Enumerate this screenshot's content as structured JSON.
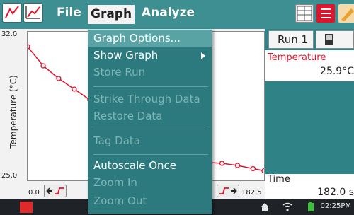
{
  "menubar": {
    "file_label": "File",
    "graph_label": "Graph",
    "analyze_label": "Analyze"
  },
  "dropdown": {
    "items": [
      {
        "label": "Graph Options...",
        "enabled": true,
        "selected": true
      },
      {
        "label": "Show Graph",
        "enabled": true,
        "submenu": true
      },
      {
        "label": "Store Run",
        "enabled": false
      },
      {
        "label": "Strike Through Data",
        "enabled": false
      },
      {
        "label": "Restore Data",
        "enabled": false
      },
      {
        "label": "Tag Data",
        "enabled": false
      },
      {
        "label": "Autoscale Once",
        "enabled": true
      },
      {
        "label": "Zoom In",
        "enabled": false
      },
      {
        "label": "Zoom Out",
        "enabled": false
      }
    ]
  },
  "graph": {
    "ymax_label": "32.0",
    "ymin_label": "25.0",
    "ylabel": "Temperature (°C)",
    "xmin_label": "0.0",
    "xmax_label": "182.5"
  },
  "chart_data": {
    "type": "line",
    "xlim": [
      0.0,
      182.5
    ],
    "ylim": [
      25.0,
      32.0
    ],
    "series": [
      {
        "x": [
          0,
          12,
          24,
          36,
          48
        ],
        "y": [
          31.3,
          30.4,
          29.8,
          29.3,
          28.8
        ]
      },
      {
        "x": [
          125,
          137,
          150,
          162,
          174,
          182.5
        ],
        "y": [
          25.9,
          25.85,
          25.8,
          25.7,
          25.55,
          25.45
        ]
      }
    ],
    "line_color": "#e0142d"
  },
  "side": {
    "run_label": "Run 1",
    "meter_name": "Temperature",
    "meter_value": "25.9°C",
    "time_name": "Time",
    "time_value": "182.0 s"
  },
  "status": {
    "clock": "02:25PM"
  }
}
